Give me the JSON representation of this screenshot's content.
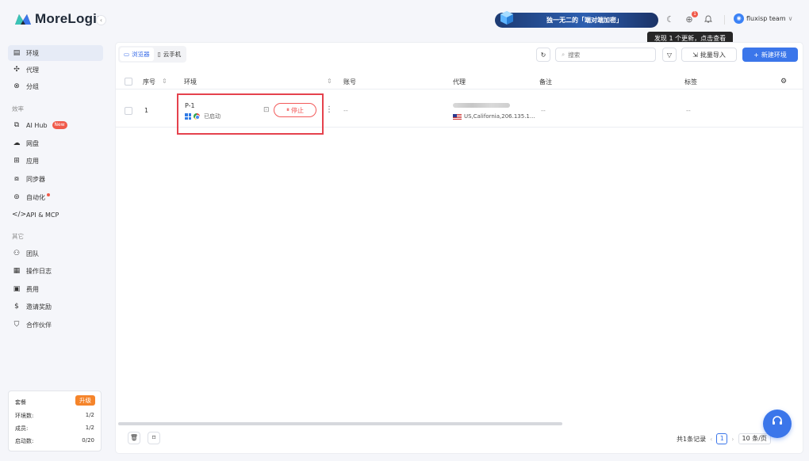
{
  "app": {
    "logo_text": "MoreLogin",
    "collapse_icon": "chevron-left-icon",
    "promo_text": "独一无二的「端对端加密」",
    "tooltip": "发现 1 个更新，点击查看",
    "notification_count": "1",
    "team_name": "fluxisp team"
  },
  "sidebar": {
    "items_top": [
      {
        "label": "环境",
        "icon": "file-icon",
        "active": true
      },
      {
        "label": "代理",
        "icon": "proxy-icon"
      },
      {
        "label": "分组",
        "icon": "group-icon"
      }
    ],
    "group_efficiency": "效率",
    "items_eff": [
      {
        "label": "AI Hub",
        "icon": "ai-icon",
        "badge": "New"
      },
      {
        "label": "网盘",
        "icon": "cloud-icon"
      },
      {
        "label": "应用",
        "icon": "apps-icon"
      },
      {
        "label": "同步器",
        "icon": "sync-icon"
      },
      {
        "label": "自动化",
        "icon": "robot-icon",
        "dot": true
      },
      {
        "label": "API & MCP",
        "icon": "code-icon"
      }
    ],
    "group_other": "其它",
    "items_other": [
      {
        "label": "团队",
        "icon": "team-icon"
      },
      {
        "label": "操作日志",
        "icon": "log-icon"
      },
      {
        "label": "费用",
        "icon": "billing-icon"
      },
      {
        "label": "邀请奖励",
        "icon": "dollar-icon"
      },
      {
        "label": "合作伙伴",
        "icon": "partner-icon"
      }
    ],
    "plan": {
      "title": "套餐",
      "upgrade": "升级",
      "rows": [
        {
          "label": "环境数:",
          "value": "1/2"
        },
        {
          "label": "成员:",
          "value": "1/2"
        },
        {
          "label": "启动数:",
          "value": "0/20"
        }
      ]
    }
  },
  "toolbar": {
    "tab_browser": "浏览器",
    "tab_phone": "云手机",
    "search_placeholder": "搜索",
    "batch_import": "批量导入",
    "new_env": "新建环境"
  },
  "table": {
    "headers": {
      "index": "序号",
      "env": "环境",
      "account": "账号",
      "proxy": "代理",
      "note": "备注",
      "tag": "标签"
    },
    "rows": [
      {
        "index": "1",
        "env_name": "P-1",
        "status": "已启动",
        "stop_label": "停止",
        "account": "--",
        "proxy": "US,California,206.135.1...",
        "note": "--",
        "tag": "--"
      }
    ]
  },
  "footer": {
    "total": "共1条记录",
    "page": "1",
    "per_page": "10 条/页"
  }
}
